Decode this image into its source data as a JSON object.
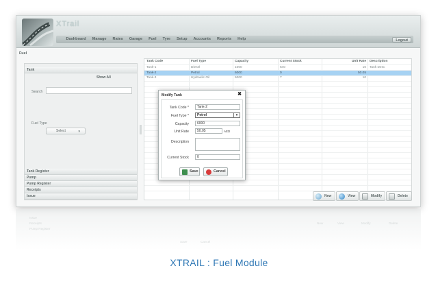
{
  "app": {
    "brand": "XTrail",
    "logout_label": "Logout",
    "nav": [
      "Dashboard",
      "Manage",
      "Rates",
      "Garage",
      "Fuel",
      "Tyre",
      "Setup",
      "Accounts",
      "Reports",
      "Help"
    ]
  },
  "page": {
    "title": "Fuel"
  },
  "sidebar": {
    "top_section": "Tank",
    "show_all": "Show All",
    "search_label": "Search",
    "search_value": "",
    "fuel_type_label": "Fuel Type",
    "fuel_type_value": "Select",
    "sections": [
      "Tank Register",
      "Pump",
      "Pump Register",
      "Receipts",
      "Issue"
    ]
  },
  "table": {
    "columns": [
      "Tank Code",
      "Fuel Type",
      "Capacity",
      "Current Stock",
      "Unit Rate",
      "Description"
    ],
    "rows": [
      [
        "Tank-1",
        "Diesel",
        "1000",
        "640",
        "10",
        "Tank Desc"
      ],
      [
        "Tank-2",
        "Petrol",
        "6000",
        "0",
        "50.05",
        ""
      ],
      [
        "Tank-3",
        "Hydraulic Oil",
        "5000",
        "7",
        "10",
        ""
      ]
    ],
    "selected_row": 1
  },
  "actions": {
    "new": "New",
    "view": "View",
    "modify": "Modify",
    "delete": "Delete"
  },
  "modal": {
    "title": "Modify Tank",
    "close": "✖",
    "fields": {
      "tank_code_label": "Tank Code",
      "tank_code_value": "Tank-2",
      "fuel_type_label": "Fuel Type",
      "fuel_type_value": "Petrol",
      "capacity_label": "Capacity",
      "capacity_value": "6000",
      "unit_rate_label": "Unit Rate",
      "unit_rate_value": "50.05",
      "unit_rate_unit": "AED",
      "description_label": "Description",
      "description_value": "",
      "current_stock_label": "Current Stock",
      "current_stock_value": "0"
    },
    "required_mark": "*",
    "save_label": "Save",
    "cancel_label": "Cancel"
  },
  "caption": "XTRAIL : Fuel Module",
  "colors": {
    "selected_row": "#a6d2f3",
    "caption": "#2e77b5",
    "save_icon": "#3e8e4e",
    "cancel_icon": "#d83b3b"
  }
}
